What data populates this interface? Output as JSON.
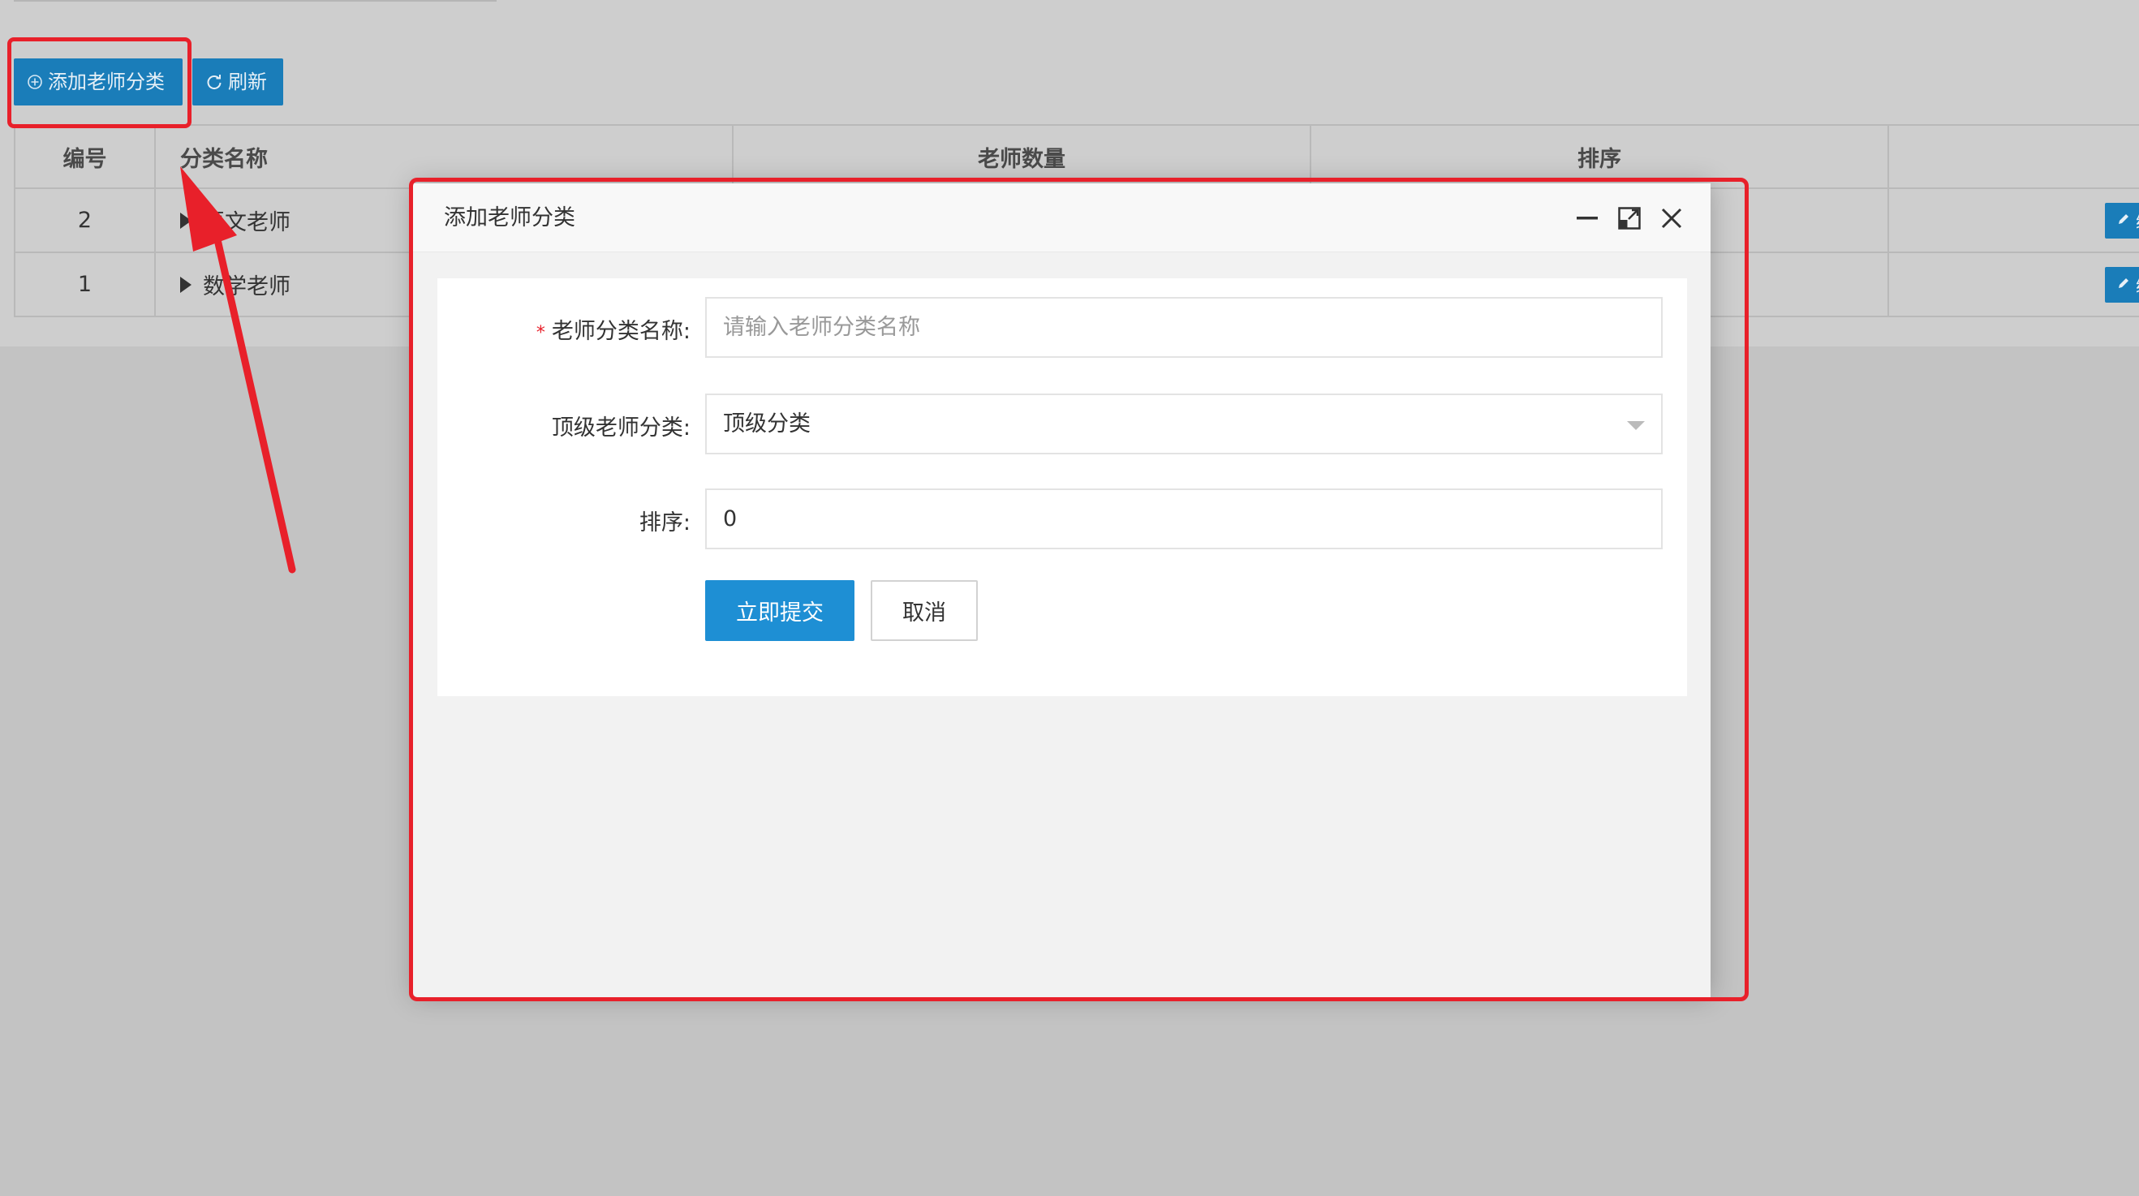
{
  "toolbar": {
    "add_label": "添加老师分类",
    "refresh_label": "刷新"
  },
  "table": {
    "headers": [
      "编号",
      "分类名称",
      "老师数量",
      "排序",
      ""
    ],
    "rows": [
      {
        "id": "2",
        "name": "语文老师"
      },
      {
        "id": "1",
        "name": "数学老师"
      }
    ],
    "edit_label": "编"
  },
  "modal": {
    "title": "添加老师分类",
    "fields": {
      "name_label": "老师分类名称:",
      "name_placeholder": "请输入老师分类名称",
      "parent_label": "顶级老师分类:",
      "parent_value": "顶级分类",
      "sort_label": "排序:",
      "sort_value": "0"
    },
    "submit_label": "立即提交",
    "cancel_label": "取消"
  },
  "annotation": {
    "highlight_color": "#e8202a"
  }
}
